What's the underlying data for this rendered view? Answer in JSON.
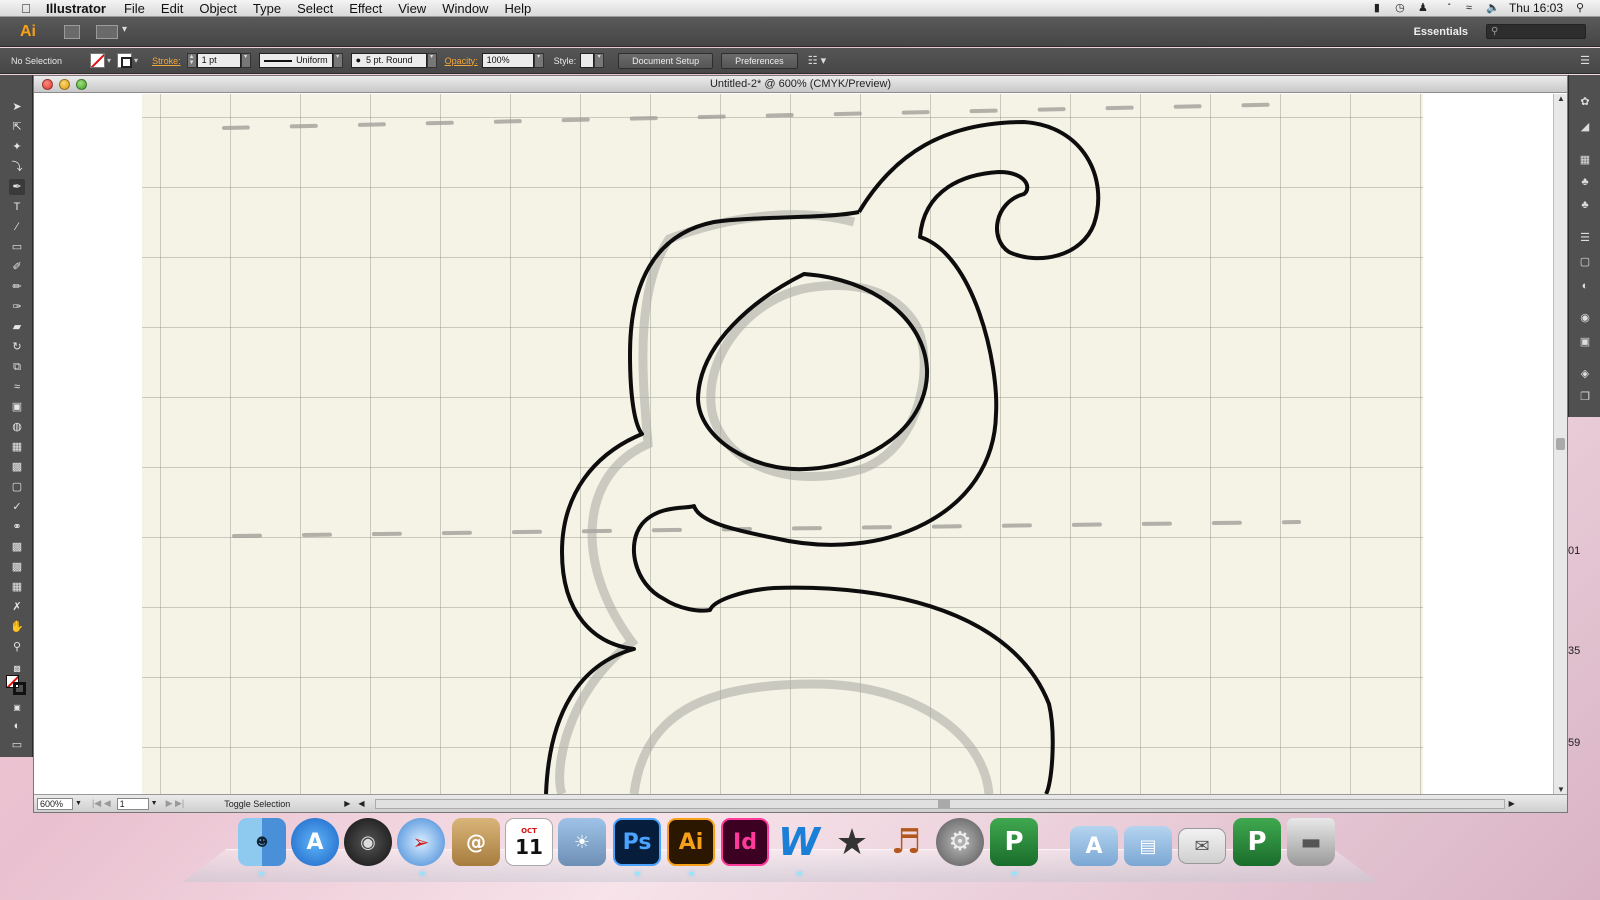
{
  "menubar": {
    "app_name": "Illustrator",
    "menus": [
      "File",
      "Edit",
      "Object",
      "Type",
      "Select",
      "Effect",
      "View",
      "Window",
      "Help"
    ],
    "clock": "Thu 16:03"
  },
  "appbar": {
    "logo": "Ai",
    "workspace": "Essentials"
  },
  "control": {
    "selection_label": "No Selection",
    "stroke_label": "Stroke:",
    "stroke_weight": "1 pt",
    "stroke_profile": "Uniform",
    "brush": "5 pt. Round",
    "opacity_label": "Opacity:",
    "opacity_value": "100%",
    "style_label": "Style:",
    "document_setup": "Document Setup",
    "preferences": "Preferences"
  },
  "document": {
    "title": "Untitled-2* @ 600% (CMYK/Preview)",
    "zoom": "600%",
    "page": "1",
    "status": "Toggle Selection"
  },
  "colors": {
    "accent": "#f6a01a",
    "paper": "#f5f3e6",
    "close": "#d8352a",
    "minimize": "#d79a13",
    "zoom": "#3c9e27"
  },
  "tools": [
    "selection-icon",
    "direct-selection-icon",
    "magic-wand-icon",
    "lasso-icon",
    "pen-icon",
    "type-icon",
    "line-icon",
    "rectangle-icon",
    "paintbrush-icon",
    "pencil-icon",
    "blob-brush-icon",
    "eraser-icon",
    "rotate-icon",
    "scale-icon",
    "width-icon",
    "free-transform-icon",
    "shape-builder-icon",
    "perspective-grid-icon",
    "mesh-icon",
    "gradient-icon",
    "eyedropper-icon",
    "blend-icon",
    "symbol-sprayer-icon",
    "graph-icon",
    "artboard-icon",
    "slice-icon",
    "hand-icon",
    "zoom-icon"
  ],
  "right_panels": [
    "color-guide-icon",
    "brushes-icon",
    "swatches-icon",
    "symbols-icon",
    "stroke-icon",
    "gradient-panel-icon",
    "transparency-icon",
    "appearance-icon",
    "graphic-styles-icon",
    "layers-icon",
    "artboards-icon"
  ],
  "peek_labels": [
    ".01",
    ".35",
    ".59"
  ],
  "dock": {
    "calendar_month": "OCT",
    "calendar_day": "11",
    "apps": [
      "Finder",
      "App Store",
      "Dashboard",
      "Safari",
      "Address Book",
      "iCal",
      "iPhoto",
      "Photoshop",
      "Illustrator",
      "InDesign",
      "Word",
      "iMovie",
      "GarageBand",
      "System Preferences",
      "Publisher",
      "Applications",
      "Documents",
      "Downloads",
      "Publisher 2",
      "Trash"
    ],
    "ps_label": "Ps",
    "ai_label": "Ai",
    "id_label": "Id",
    "w_label": "W",
    "p_label": "P"
  }
}
